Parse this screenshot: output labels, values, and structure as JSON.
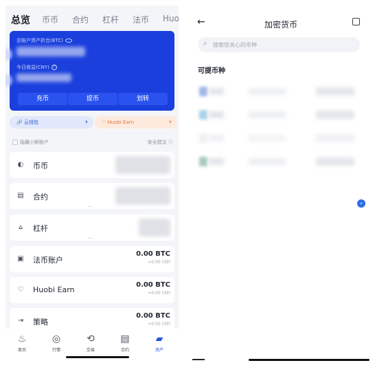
{
  "left": {
    "tabs": [
      "总览",
      "币币",
      "合约",
      "杠杆",
      "法币",
      "Huo"
    ],
    "card": {
      "total_label": "总账户资产折合(BTC)",
      "today_label": "今日收益(CNY)",
      "buttons": [
        "充币",
        "提币",
        "划转"
      ]
    },
    "pills": {
      "cloud": "云钱包",
      "earn": "Huobi Earn"
    },
    "hide_small": "隐藏小额账户",
    "safety": "安全建议",
    "accounts": [
      {
        "name": "币币",
        "amount": "",
        "sub": ""
      },
      {
        "name": "合约",
        "amount": "",
        "sub": ""
      },
      {
        "name": "杠杆",
        "amount": "",
        "sub": ""
      },
      {
        "name": "法币账户",
        "amount": "0.00 BTC",
        "sub": "≈0.00 CNY"
      },
      {
        "name": "Huobi Earn",
        "amount": "0.00 BTC",
        "sub": "≈0.00 CNY"
      },
      {
        "name": "策略",
        "amount": "0.00 BTC",
        "sub": "≈0.00 CNY"
      }
    ],
    "nav": [
      "首页",
      "行情",
      "交易",
      "合约",
      "资产"
    ]
  },
  "right": {
    "title": "加密货币",
    "search_placeholder": "搜索您关心的币种",
    "section": "可提币种"
  },
  "colors": {
    "accent": "#1a3fdc",
    "nav_active": "#2456e6",
    "earn": "#e1753a"
  }
}
